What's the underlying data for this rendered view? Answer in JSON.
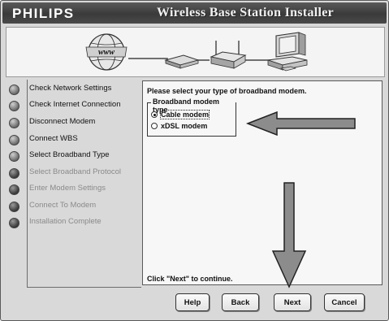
{
  "window": {
    "brand": "PHILIPS",
    "title": "Wireless Base Station Installer"
  },
  "banner": {
    "globe_label": "www",
    "icons": [
      "globe-icon",
      "modem-icon",
      "router-icon",
      "computer-icon"
    ]
  },
  "steps": [
    {
      "label": "Check Network Settings",
      "enabled": true
    },
    {
      "label": "Check Internet Connection",
      "enabled": true
    },
    {
      "label": "Disconnect Modem",
      "enabled": true
    },
    {
      "label": "Connect WBS",
      "enabled": true
    },
    {
      "label": "Select Broadband Type",
      "enabled": true
    },
    {
      "label": "Select Broadband Protocol",
      "enabled": false
    },
    {
      "label": "Enter Modem Settings",
      "enabled": false
    },
    {
      "label": "Connect To Modem",
      "enabled": false
    },
    {
      "label": "Installation Complete",
      "enabled": false
    }
  ],
  "content": {
    "prompt": "Please select your type of broadband modem.",
    "group_title": "Broadband modem type",
    "options": [
      {
        "label": "Cable modem",
        "selected": true
      },
      {
        "label": "xDSL modem",
        "selected": false
      }
    ],
    "footer": "Click \"Next\" to continue."
  },
  "buttons": {
    "help": "Help",
    "back": "Back",
    "next": "Next",
    "cancel": "Cancel"
  },
  "colors": {
    "titlebar": "#3a3a3a",
    "arrow_fill": "#8c8c8c",
    "arrow_stroke": "#222222"
  }
}
